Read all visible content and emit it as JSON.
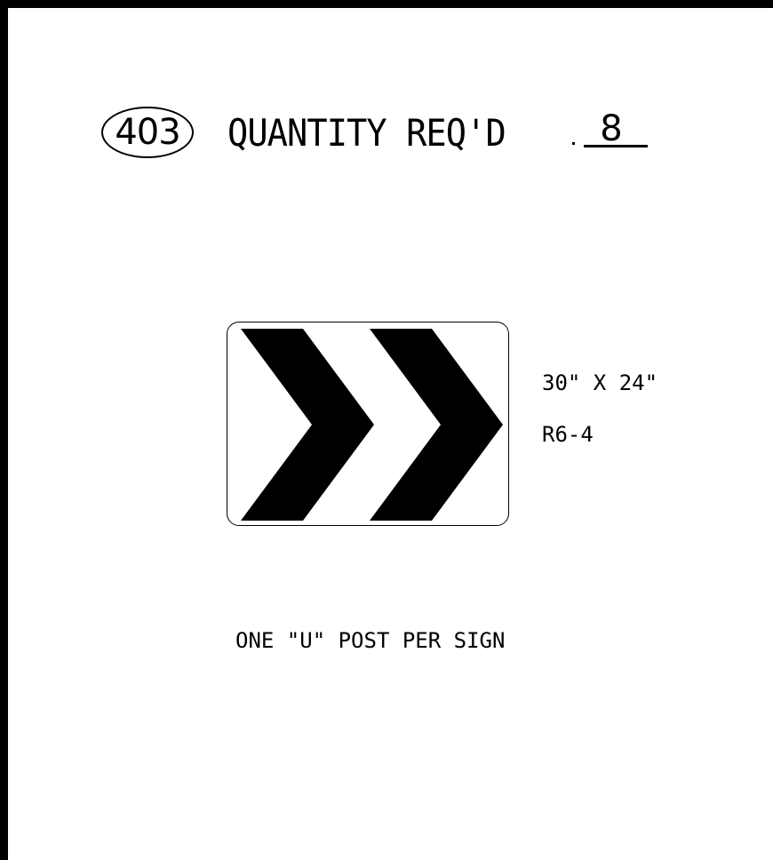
{
  "sheet": {
    "number": "403",
    "quantity_label": "QUANTITY REQ'D",
    "quantity_value": "8"
  },
  "sign": {
    "icon": "double-chevron-right-icon",
    "size": "30\" X 24\"",
    "code": "R6-4"
  },
  "note": "ONE \"U\" POST PER SIGN"
}
